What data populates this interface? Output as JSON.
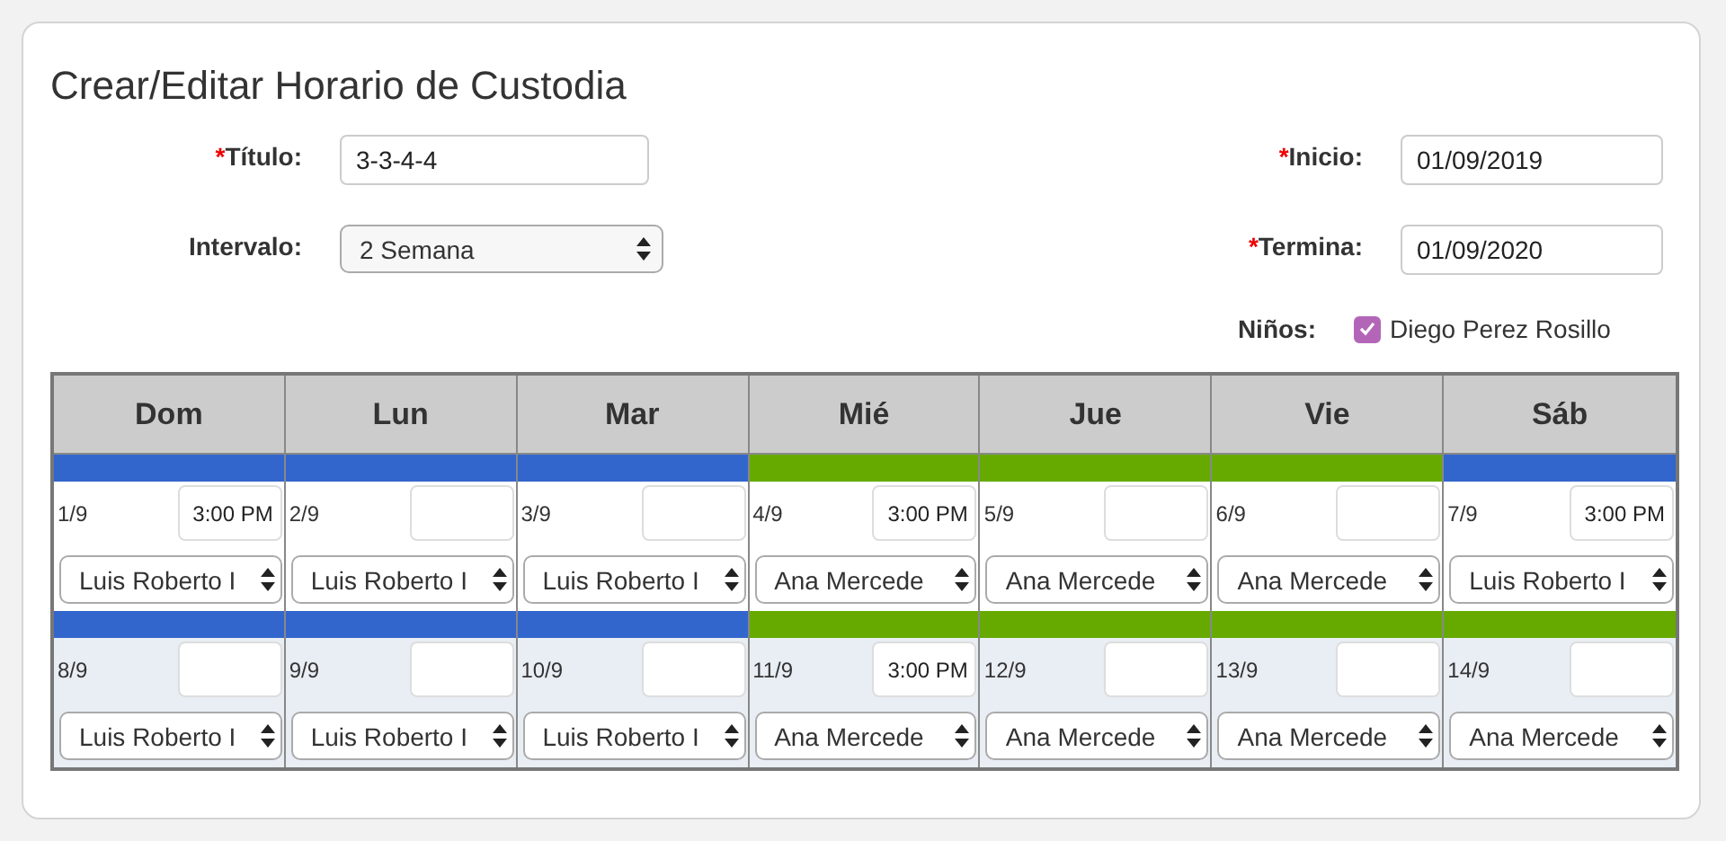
{
  "title": "Crear/Editar Horario de Custodia",
  "form_rows": [
    {
      "left": {
        "label": "Título:",
        "required_mark": "*",
        "kind": "text",
        "value": "3-3-4-4"
      },
      "right": {
        "label": "Inicio:",
        "required_mark": "*",
        "kind": "text",
        "value": "01/09/2019"
      }
    },
    {
      "left": {
        "label": "Intervalo:",
        "kind": "select",
        "value": "2 Semana"
      },
      "right": {
        "label": "Termina:",
        "required_mark": "*",
        "kind": "text",
        "value": "01/09/2020"
      }
    }
  ],
  "children": {
    "label": "Niños:",
    "items": [
      {
        "name": "Diego Perez Rosillo",
        "checked": true
      }
    ]
  },
  "calendar": {
    "columns": [
      "Dom",
      "Lun",
      "Mar",
      "Mié",
      "Jue",
      "Vie",
      "Sáb"
    ],
    "weeks": [
      {
        "days": [
          {
            "date": "1/9",
            "time": "3:00 PM",
            "person": "Luis Roberto I",
            "color": "#3366cc"
          },
          {
            "date": "2/9",
            "person": "Luis Roberto I",
            "color": "#3366cc"
          },
          {
            "date": "3/9",
            "person": "Luis Roberto I",
            "color": "#3366cc"
          },
          {
            "date": "4/9",
            "time": "3:00 PM",
            "person": "Ana Mercede",
            "color": "#66aa00"
          },
          {
            "date": "5/9",
            "person": "Ana Mercede",
            "color": "#66aa00"
          },
          {
            "date": "6/9",
            "person": "Ana Mercede",
            "color": "#66aa00"
          },
          {
            "date": "7/9",
            "time": "3:00 PM",
            "person": "Luis Roberto I",
            "color": "#3366cc"
          }
        ]
      },
      {
        "days": [
          {
            "date": "8/9",
            "person": "Luis Roberto I",
            "color": "#3366cc"
          },
          {
            "date": "9/9",
            "person": "Luis Roberto I",
            "color": "#3366cc"
          },
          {
            "date": "10/9",
            "person": "Luis Roberto I",
            "color": "#3366cc"
          },
          {
            "date": "11/9",
            "time": "3:00 PM",
            "person": "Ana Mercede",
            "color": "#66aa00"
          },
          {
            "date": "12/9",
            "person": "Ana Mercede",
            "color": "#66aa00"
          },
          {
            "date": "13/9",
            "person": "Ana Mercede",
            "color": "#66aa00"
          },
          {
            "date": "14/9",
            "person": "Ana Mercede",
            "color": "#66aa00"
          }
        ]
      }
    ]
  }
}
